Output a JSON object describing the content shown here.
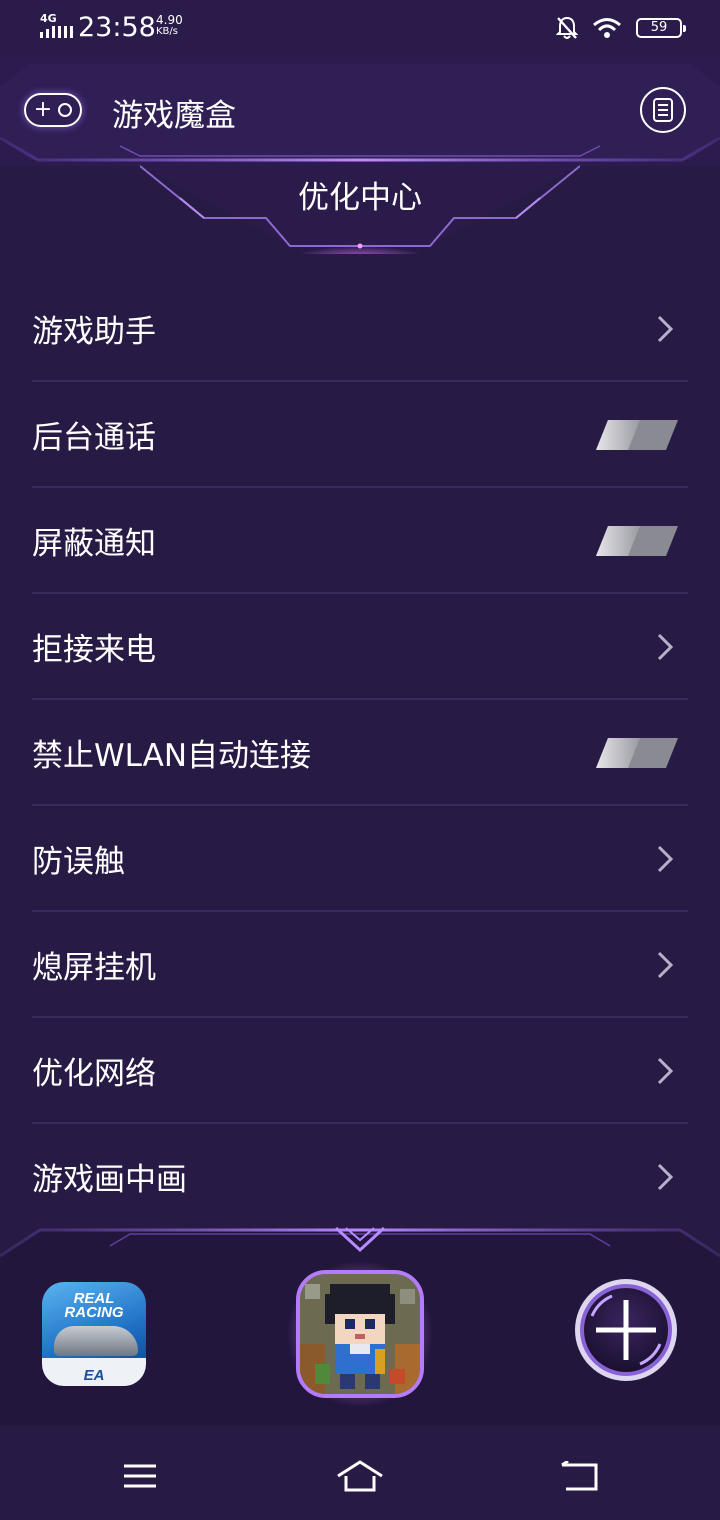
{
  "status_bar": {
    "network_type": "4G",
    "time": "23:58",
    "speed_value": "4.90",
    "speed_unit": "KB/s",
    "battery_level": "59",
    "icons": [
      "signal-icon",
      "mute-bell-icon",
      "wifi-icon",
      "battery-icon"
    ]
  },
  "header": {
    "title": "游戏魔盒",
    "left_icon": "plus-circle-icon",
    "right_icon": "document-icon"
  },
  "section": {
    "title": "优化中心"
  },
  "settings": [
    {
      "label": "游戏助手",
      "control": "chevron"
    },
    {
      "label": "后台通话",
      "control": "toggle",
      "on": false
    },
    {
      "label": "屏蔽通知",
      "control": "toggle",
      "on": false
    },
    {
      "label": "拒接来电",
      "control": "chevron"
    },
    {
      "label": "禁止WLAN自动连接",
      "control": "toggle",
      "on": false
    },
    {
      "label": "防误触",
      "control": "chevron"
    },
    {
      "label": "熄屏挂机",
      "control": "chevron"
    },
    {
      "label": "优化网络",
      "control": "chevron"
    },
    {
      "label": "游戏画中画",
      "control": "chevron"
    }
  ],
  "dock": {
    "realracing_text_1": "REAL",
    "realracing_text_2": "RACING",
    "realracing_brand": "EA",
    "add_icon": "plus-crosshair-icon"
  },
  "nav": [
    "menu-icon",
    "home-icon",
    "back-icon"
  ],
  "colors": {
    "background": "#271a44",
    "accent": "#b57bff",
    "divider": "#3a2b5c"
  }
}
